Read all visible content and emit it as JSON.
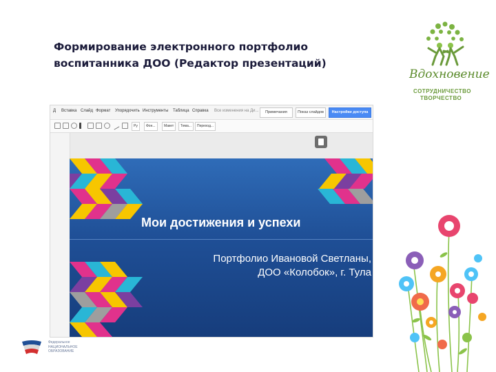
{
  "title": {
    "line1": "Формирование электронного портфолио",
    "line2": "воспитанника  ДОО (Редактор презентаций)"
  },
  "logo": {
    "brand": "Вдохновение",
    "tagline1": "СОТРУДНИЧЕСТВО",
    "tagline2": "ТВОРЧЕСТВО"
  },
  "editor": {
    "menu": [
      {
        "label": "Д",
        "faint": false
      },
      {
        "label": "Вставка",
        "faint": false
      },
      {
        "label": "Слайд",
        "faint": false
      },
      {
        "label": "Формат",
        "faint": false
      },
      {
        "label": "Упорядочить",
        "faint": false
      },
      {
        "label": "Инструменты",
        "faint": false
      },
      {
        "label": "Таблица",
        "faint": false
      },
      {
        "label": "Справка",
        "faint": false
      },
      {
        "label": "Все изменения на Ди...",
        "faint": true
      }
    ],
    "comments_label": "Примечания",
    "present_label": "Показ слайдов",
    "share_label": "Настройки доступа",
    "toolbar": {
      "font_size": "Ру",
      "background": "Фон...",
      "layout": "Макет",
      "theme": "Тема...",
      "transition": "Переход..."
    },
    "slide": {
      "title": "Мои достижения и успехи",
      "subtitle_line1": "Портфолио Ивановой Светланы,",
      "subtitle_line2": "ДОО «Колобок», г. Тула"
    }
  },
  "footer": {
    "org_line1": "Федеральное",
    "org_line2": "НАЦИОНАЛЬНОЕ",
    "org_line3": "ОБРАЗОВАНИЕ"
  },
  "colors": {
    "title_text": "#1b1b3a",
    "slide_bg": "#1f4f96",
    "share_button": "#4a8af4",
    "logo_green": "#5a8a2a"
  }
}
